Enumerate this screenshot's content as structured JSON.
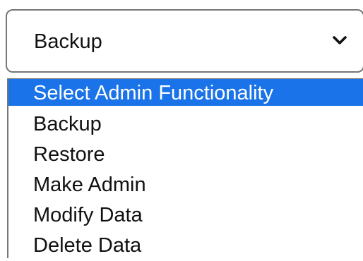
{
  "select": {
    "value": "Backup",
    "chevron_icon": "chevron-down-icon",
    "border_color": "#767676"
  },
  "dropdown": {
    "highlight_color": "#1a73e8",
    "options": [
      {
        "label": "Select Admin Functionality",
        "highlighted": true
      },
      {
        "label": "Backup",
        "highlighted": false
      },
      {
        "label": "Restore",
        "highlighted": false
      },
      {
        "label": "Make Admin",
        "highlighted": false
      },
      {
        "label": "Modify Data",
        "highlighted": false
      },
      {
        "label": "Delete Data",
        "highlighted": false
      }
    ]
  }
}
